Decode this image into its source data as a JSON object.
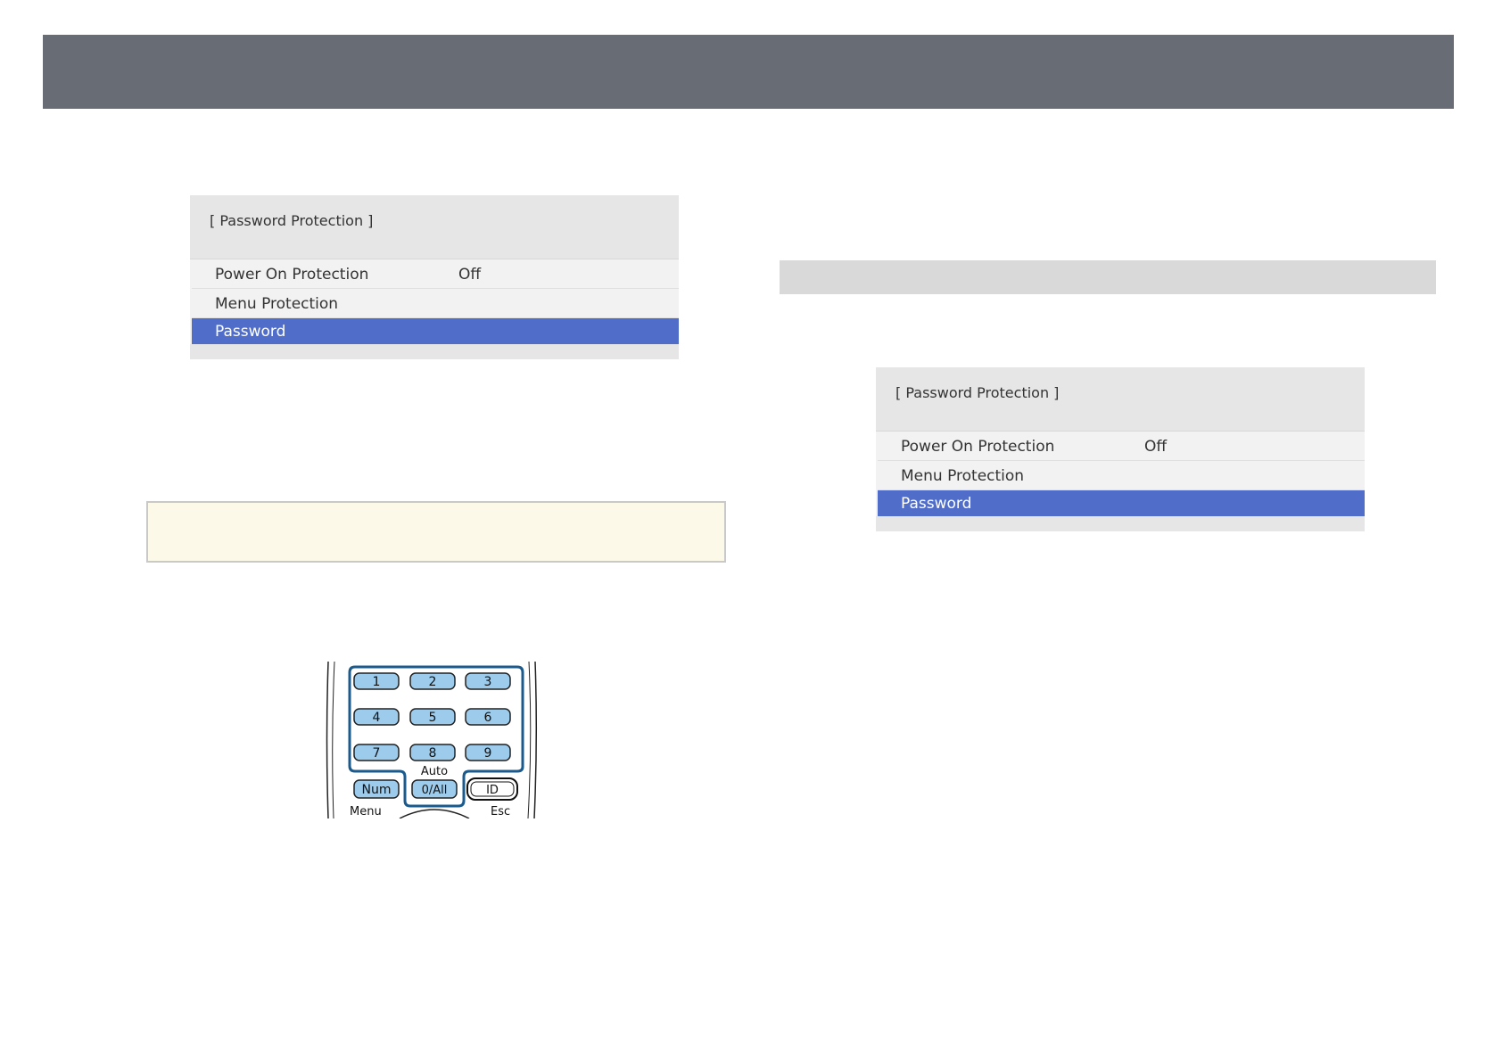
{
  "menu": {
    "title": "[ Password Protection ]",
    "items": [
      {
        "label": "Power On Protection",
        "value": "Off"
      },
      {
        "label": "Menu Protection",
        "value": ""
      },
      {
        "label": "Password",
        "value": ""
      }
    ],
    "selected_index": 2,
    "colors": {
      "highlight": "#506ec9",
      "panel": "#f2f2f2",
      "title_bg": "#e6e6e6"
    }
  },
  "remote": {
    "keys": [
      "1",
      "2",
      "3",
      "4",
      "5",
      "6",
      "7",
      "8",
      "9"
    ],
    "num_label": "Num",
    "zero_label": "0/All",
    "auto_label": "Auto",
    "id_label": "ID",
    "menu_label": "Menu",
    "esc_label": "Esc",
    "colors": {
      "key_fill": "#9ccbec",
      "highlight_outline": "#1b5a8c"
    }
  },
  "page": {
    "header_color": "#686c75",
    "note_bg": "#fcf9e8",
    "strip_color": "#d9d9d9"
  }
}
